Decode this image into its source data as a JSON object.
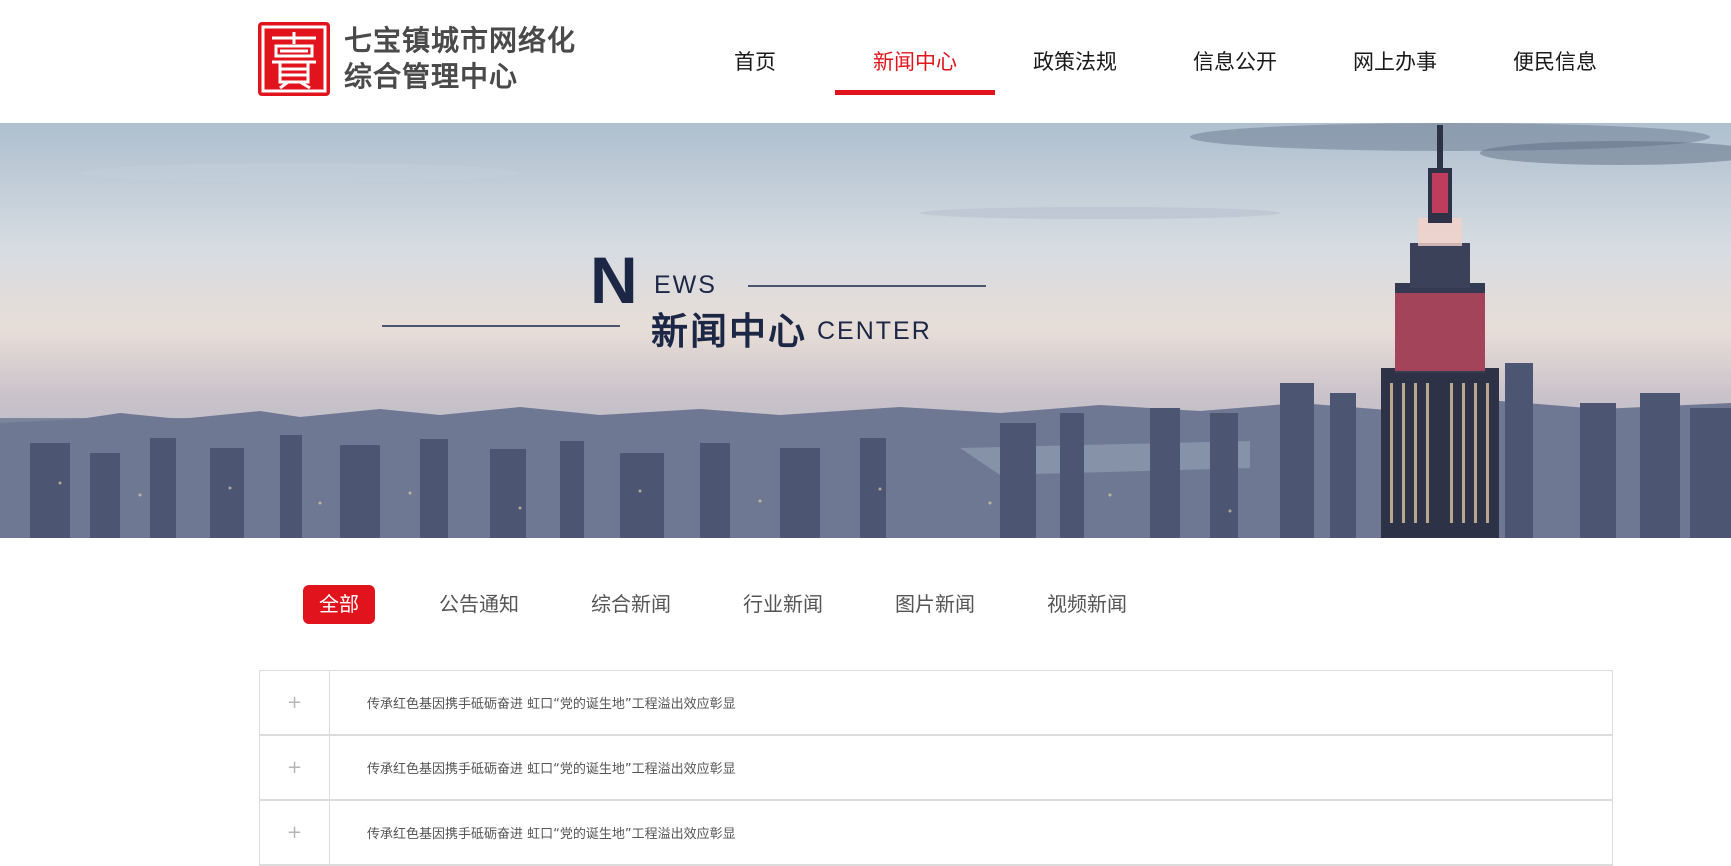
{
  "header": {
    "logo_line1": "七宝镇城市网络化",
    "logo_line2": "综合管理中心",
    "nav": [
      {
        "label": "首页",
        "active": false
      },
      {
        "label": "新闻中心",
        "active": true
      },
      {
        "label": "政策法规",
        "active": false
      },
      {
        "label": "信息公开",
        "active": false
      },
      {
        "label": "网上办事",
        "active": false
      },
      {
        "label": "便民信息",
        "active": false
      }
    ]
  },
  "banner": {
    "big_letter": "N",
    "small_en": "EWS",
    "cn_title": "新闻中心",
    "en_suffix": "CENTER"
  },
  "tabs": [
    {
      "label": "全部",
      "active": true
    },
    {
      "label": "公告通知",
      "active": false
    },
    {
      "label": "综合新闻",
      "active": false
    },
    {
      "label": "行业新闻",
      "active": false
    },
    {
      "label": "图片新闻",
      "active": false
    },
    {
      "label": "视频新闻",
      "active": false
    }
  ],
  "news": [
    {
      "icon": "+",
      "title": "传承红色基因携手砥砺奋进 虹口“党的诞生地”工程溢出效应彰显"
    },
    {
      "icon": "+",
      "title": "传承红色基因携手砥砺奋进 虹口“党的诞生地”工程溢出效应彰显"
    },
    {
      "icon": "+",
      "title": "传承红色基因携手砥砺奋进 虹口“党的诞生地”工程溢出效应彰显"
    }
  ],
  "colors": {
    "accent": "#e1141e",
    "banner_text": "#1c2746",
    "border": "#dcdcdc"
  }
}
